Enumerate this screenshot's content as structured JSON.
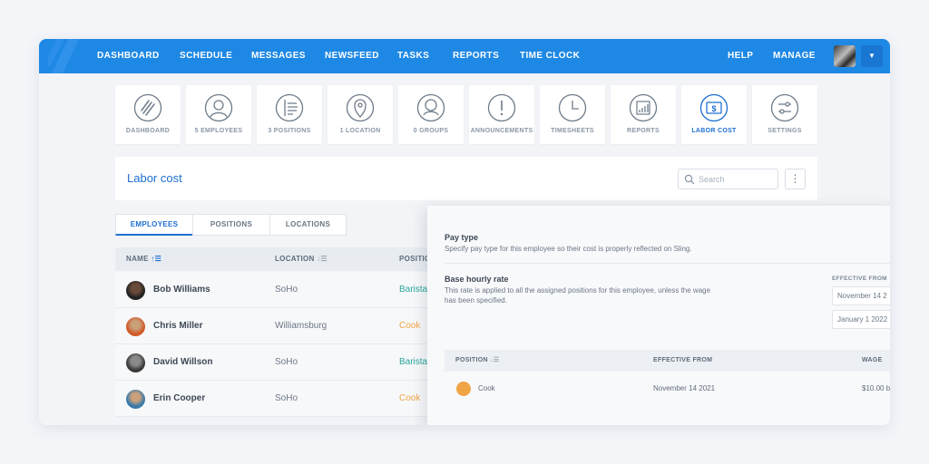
{
  "colors": {
    "brand": "#1e88e5",
    "active": "#1e6fd1",
    "barista": "#26a69a",
    "cook": "#f0a545"
  },
  "nav": {
    "items": [
      "DASHBOARD",
      "SCHEDULE",
      "MESSAGES",
      "NEWSFEED",
      "TASKS",
      "REPORTS",
      "TIME CLOCK"
    ],
    "help": "HELP",
    "manage": "MANAGE"
  },
  "tiles": [
    {
      "label": "DASHBOARD",
      "icon": "dashboard-icon"
    },
    {
      "label": "5 EMPLOYEES",
      "icon": "employee-icon"
    },
    {
      "label": "3 POSITIONS",
      "icon": "positions-icon"
    },
    {
      "label": "1 LOCATION",
      "icon": "location-pin-icon"
    },
    {
      "label": "0 GROUPS",
      "icon": "groups-icon"
    },
    {
      "label": "ANNOUNCEMENTS",
      "icon": "exclamation-icon"
    },
    {
      "label": "TIMESHEETS",
      "icon": "clock-icon"
    },
    {
      "label": "REPORTS",
      "icon": "reports-chart-icon"
    },
    {
      "label": "LABOR COST",
      "icon": "dollar-icon",
      "active": true
    },
    {
      "label": "SETTINGS",
      "icon": "sliders-icon"
    }
  ],
  "page": {
    "title": "Labor cost",
    "search_placeholder": "Search"
  },
  "tabs": [
    "EMPLOYEES",
    "POSITIONS",
    "LOCATIONS"
  ],
  "table": {
    "headers": {
      "name": "NAME",
      "location": "LOCATION",
      "position": "POSITION"
    },
    "rows": [
      {
        "name": "Bob Williams",
        "location": "SoHo",
        "position": "Barista"
      },
      {
        "name": "Chris Miller",
        "location": "Williamsburg",
        "position": "Cook"
      },
      {
        "name": "David Willson",
        "location": "SoHo",
        "position": "Barista"
      },
      {
        "name": "Erin Cooper",
        "location": "SoHo",
        "position": "Cook"
      }
    ]
  },
  "panel": {
    "pay_type": {
      "title": "Pay type",
      "desc": "Specify pay type for this employee so their cost is properly reflected on Sling."
    },
    "base_rate": {
      "title": "Base hourly rate",
      "desc": "This rate is applied to all the assigned positions for this employee, unless the wage has been specified.",
      "effective_label": "EFFECTIVE FROM",
      "dates": [
        "November 14 2",
        "January 1 2022"
      ]
    },
    "table": {
      "headers": {
        "position": "POSITION",
        "effective": "EFFECTIVE FROM",
        "wage": "WAGE"
      },
      "rows": [
        {
          "position": "Cook",
          "effective": "November 14 2021",
          "wage": "$10.00 b"
        }
      ]
    }
  }
}
